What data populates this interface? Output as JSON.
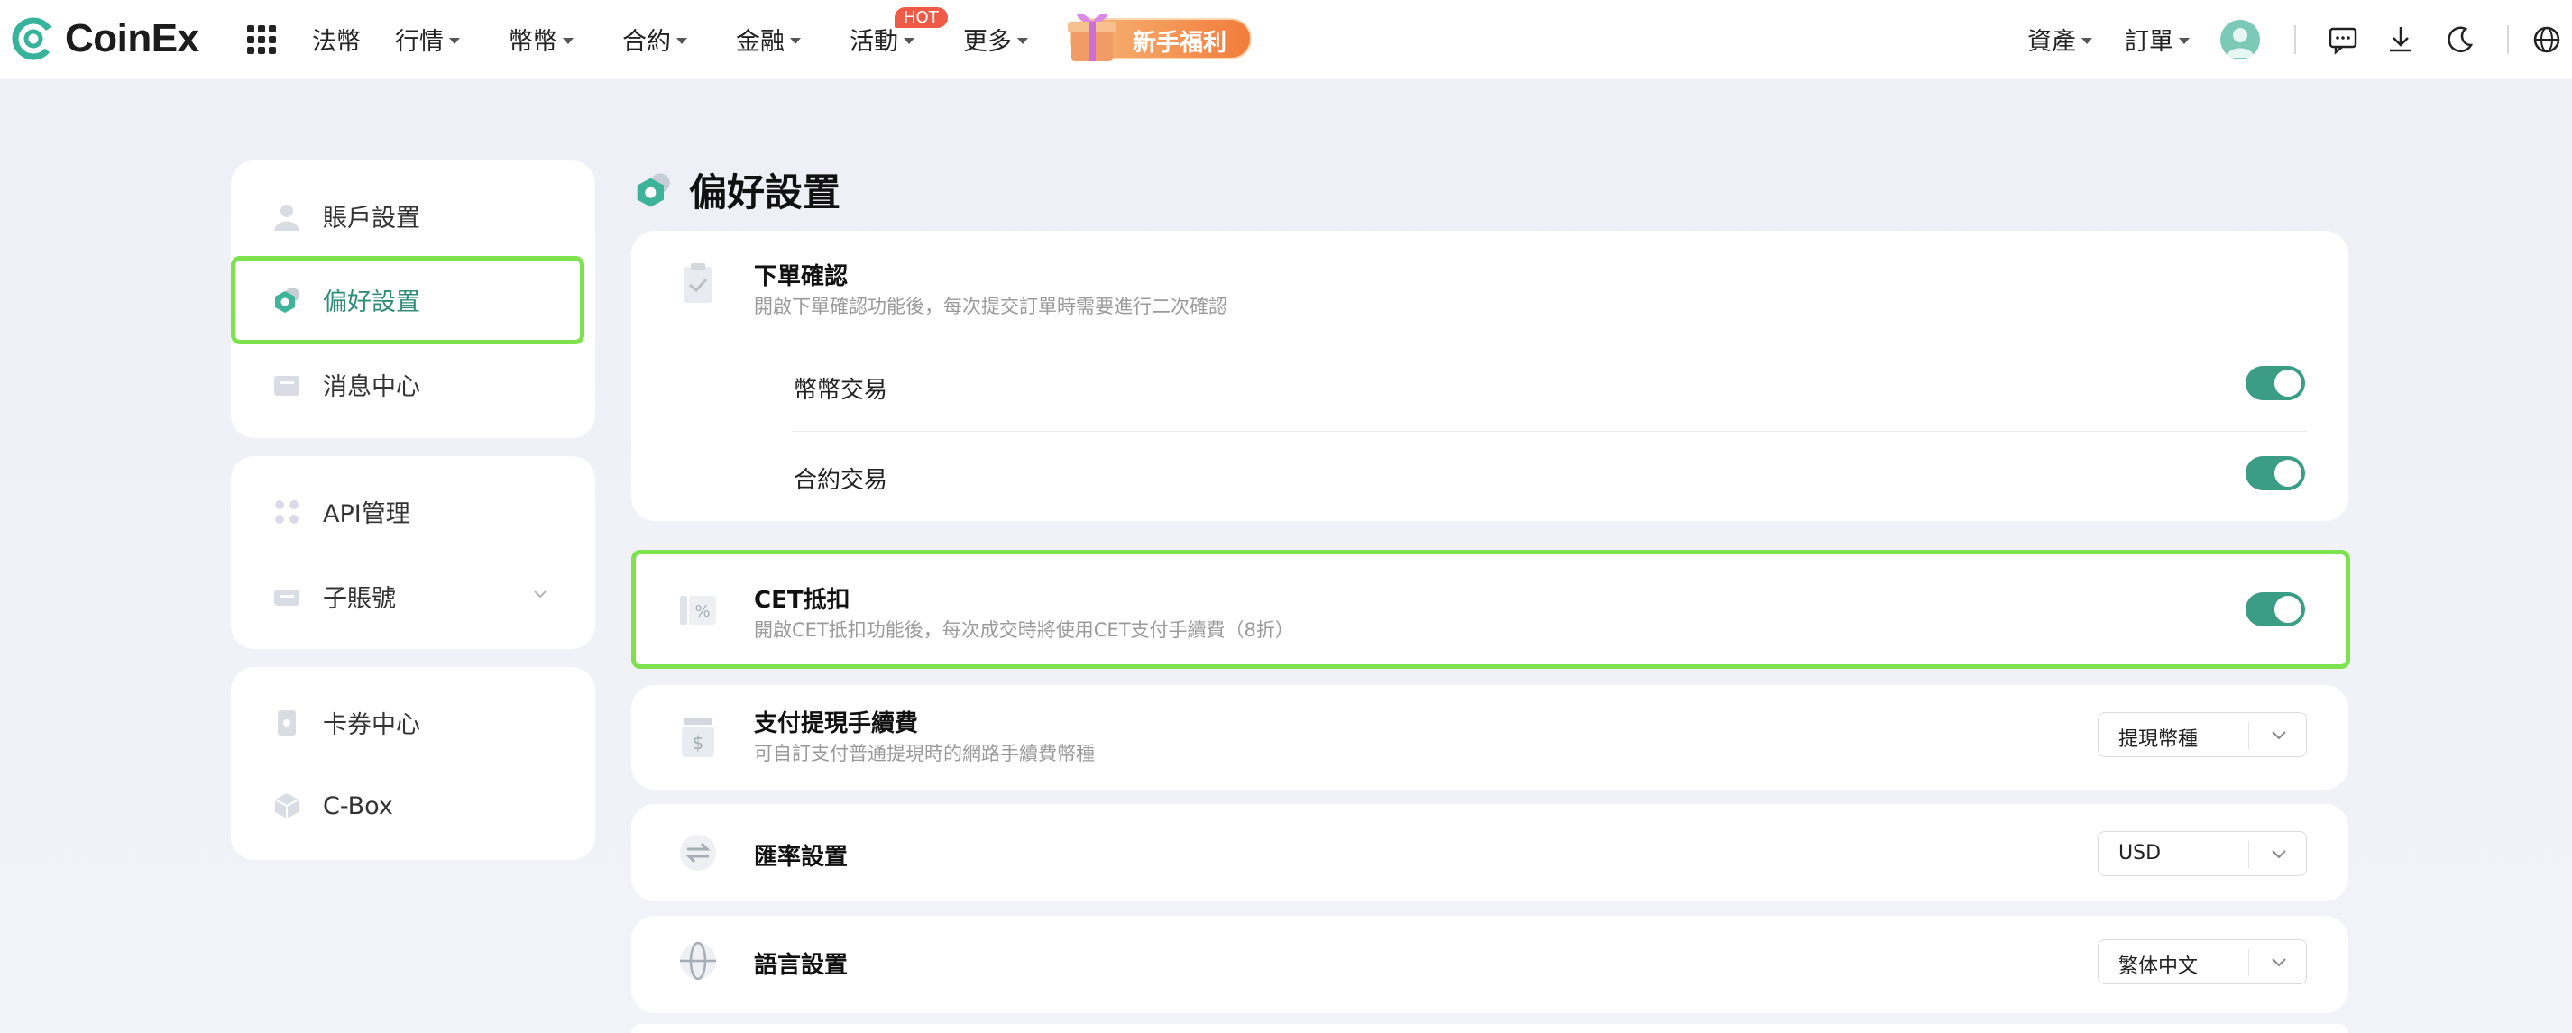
{
  "brand": {
    "name": "CoinEx",
    "accent": "#3b9d86",
    "highlight": "#7ee14e"
  },
  "topnav": {
    "items": [
      {
        "label": "法幣",
        "dropdown": false
      },
      {
        "label": "行情",
        "dropdown": true
      },
      {
        "label": "幣幣",
        "dropdown": true
      },
      {
        "label": "合約",
        "dropdown": true
      },
      {
        "label": "金融",
        "dropdown": true
      },
      {
        "label": "活動",
        "dropdown": true
      },
      {
        "label": "更多",
        "dropdown": true
      }
    ],
    "hot_badge": "HOT",
    "promo_label": "新手福利",
    "right": {
      "assets_label": "資產",
      "orders_label": "訂單"
    },
    "icons": [
      "apps-grid-icon",
      "chat-icon",
      "download-icon",
      "moon-icon",
      "globe-icon"
    ]
  },
  "sidebar": {
    "groups": [
      [
        {
          "label": "賬戶設置",
          "icon": "user-icon"
        },
        {
          "label": "偏好設置",
          "icon": "preferences-icon",
          "active": true
        },
        {
          "label": "消息中心",
          "icon": "message-icon"
        }
      ],
      [
        {
          "label": "API管理",
          "icon": "api-icon"
        },
        {
          "label": "子賬號",
          "icon": "sub-account-icon",
          "expandable": true
        }
      ],
      [
        {
          "label": "卡券中心",
          "icon": "coupon-icon"
        },
        {
          "label": "C-Box",
          "icon": "cbox-icon"
        }
      ]
    ]
  },
  "main": {
    "title": "偏好設置",
    "order_confirm": {
      "title": "下單確認",
      "desc": "開啟下單確認功能後，每次提交訂單時需要進行二次確認",
      "rows": [
        {
          "label": "幣幣交易",
          "on": true
        },
        {
          "label": "合約交易",
          "on": true
        }
      ]
    },
    "cet": {
      "title": "CET抵扣",
      "desc": "開啟CET抵扣功能後，每次成交時將使用CET支付手續費（8折）",
      "on": true
    },
    "withdraw_fee": {
      "title": "支付提現手續費",
      "desc": "可自訂支付普通提現時的網路手續費幣種",
      "select_value": "提現幣種"
    },
    "currency": {
      "title": "匯率設置",
      "select_value": "USD"
    },
    "language": {
      "title": "語言設置",
      "select_value": "繁体中文"
    }
  }
}
